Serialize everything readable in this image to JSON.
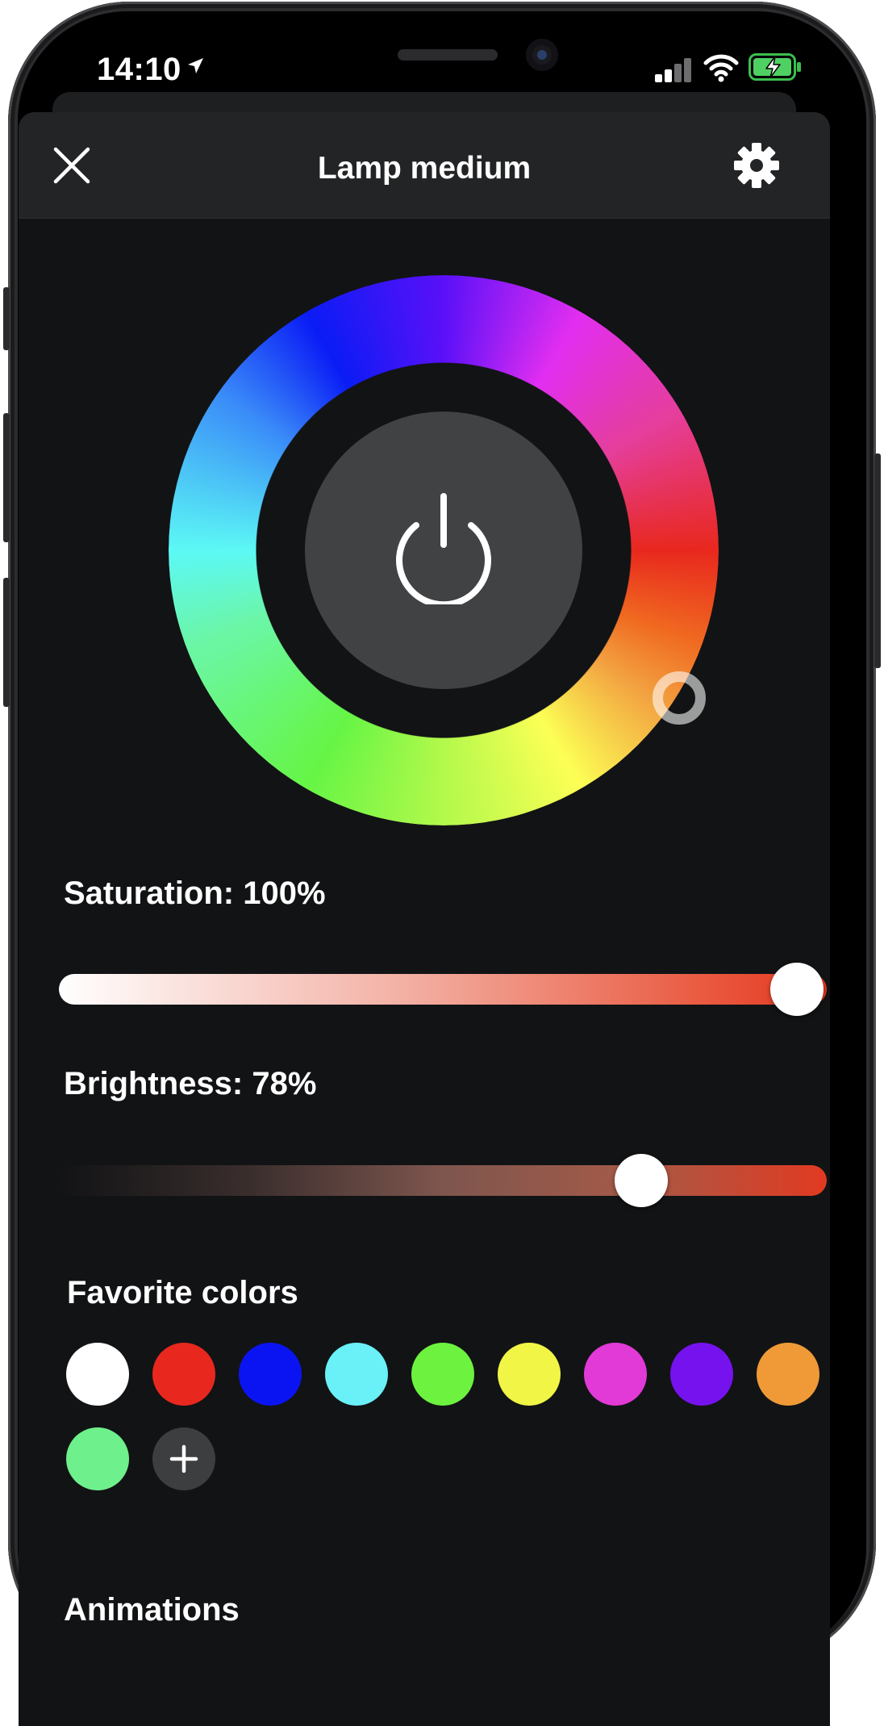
{
  "status_bar": {
    "time": "14:10"
  },
  "header": {
    "title": "Lamp medium"
  },
  "color_wheel": {
    "selected_hue_color": "#e4361f"
  },
  "saturation": {
    "label": "Saturation: 100%",
    "value_percent": 100
  },
  "brightness": {
    "label": "Brightness: 78%",
    "value_percent": 78
  },
  "favorites": {
    "title": "Favorite colors",
    "colors": [
      "#ffffff",
      "#e8281e",
      "#0a14f2",
      "#6af0f7",
      "#6cf23f",
      "#f1f545",
      "#e23ad6",
      "#7612ee",
      "#ef9a36",
      "#6ef08c"
    ]
  },
  "animations": {
    "title": "Animations"
  },
  "icons": {
    "close": "close-icon",
    "settings": "gear-icon",
    "power": "power-icon",
    "add": "plus-icon",
    "location": "location-arrow-icon",
    "signal": "signal-icon",
    "wifi": "wifi-icon",
    "battery": "battery-charging-icon"
  }
}
